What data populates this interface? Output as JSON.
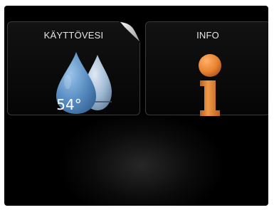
{
  "tiles": {
    "hot_water": {
      "title": "KÄYTTÖVESI",
      "temperature": "54°",
      "icon": "water-drops-icon"
    },
    "info": {
      "title": "INFO",
      "icon": "info-icon"
    }
  },
  "colors": {
    "background": "#000000",
    "tile_border": "#3a3a3a",
    "text": "#e6e6e6",
    "drop_blue": "#5a8fc4",
    "info_orange": "#e8822f"
  }
}
